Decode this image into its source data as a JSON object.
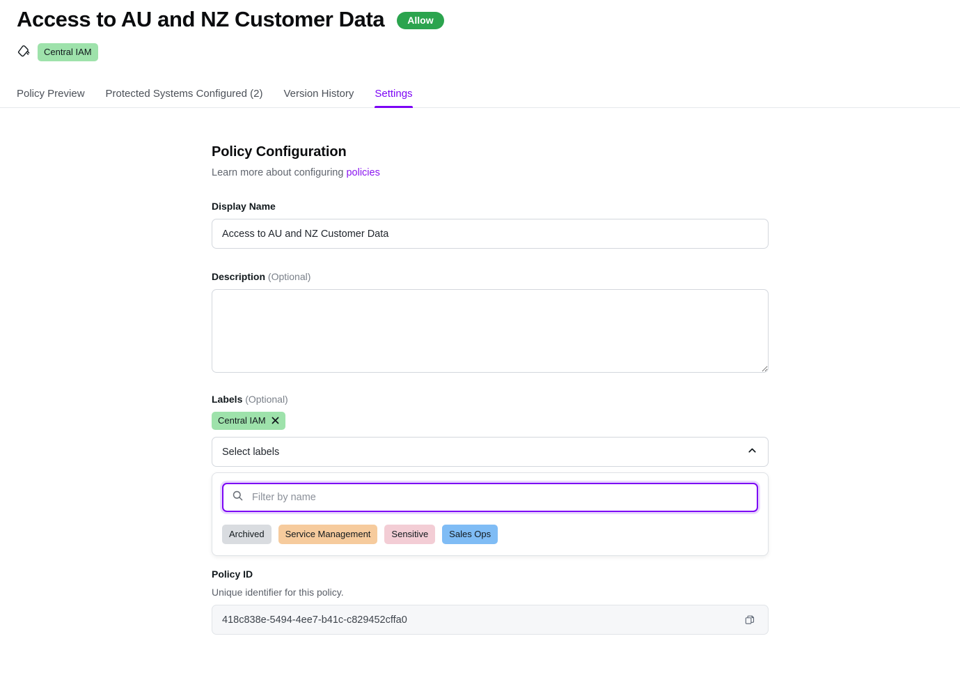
{
  "header": {
    "title": "Access to AU and NZ Customer Data",
    "status_badge": "Allow",
    "status_badge_color": "#2ba44e",
    "tag_icon": "tag-icon",
    "label_chip": "Central IAM",
    "label_chip_color": "#9ee2ab"
  },
  "tabs": [
    {
      "label": "Policy Preview",
      "active": false
    },
    {
      "label": "Protected Systems Configured (2)",
      "active": false
    },
    {
      "label": "Version History",
      "active": false
    },
    {
      "label": "Settings",
      "active": true
    }
  ],
  "active_tab_color": "#7c05f5",
  "main": {
    "section_title": "Policy Configuration",
    "section_sub_prefix": "Learn more about configuring ",
    "section_sub_link": "policies",
    "display_name": {
      "label": "Display Name",
      "value": "Access to AU and NZ Customer Data",
      "placeholder": ""
    },
    "description": {
      "label": "Description",
      "optional_suffix": "(Optional)",
      "value": "",
      "placeholder": ""
    },
    "labels": {
      "label": "Labels",
      "optional_suffix": "(Optional)",
      "selected": [
        {
          "name": "Central IAM",
          "color": "#9ee2ab",
          "remove_icon": "close-icon"
        }
      ],
      "select_placeholder": "Select labels",
      "chevron_icon": "chevron-up-icon",
      "expanded": true,
      "dropdown": {
        "search_icon": "search-icon",
        "search_value": "",
        "search_placeholder": "Filter by name",
        "options": [
          {
            "name": "Archived",
            "color": "#d9dce0"
          },
          {
            "name": "Service Management",
            "color": "#f6cb9d"
          },
          {
            "name": "Sensitive",
            "color": "#f3cdd5"
          },
          {
            "name": "Sales Ops",
            "color": "#7fbcf5"
          }
        ]
      }
    },
    "policy_id": {
      "label": "Policy ID",
      "helper": "Unique identifier for this policy.",
      "value": "418c838e-5494-4ee7-b41c-c829452cffa0",
      "copy_icon": "copy-icon"
    }
  }
}
